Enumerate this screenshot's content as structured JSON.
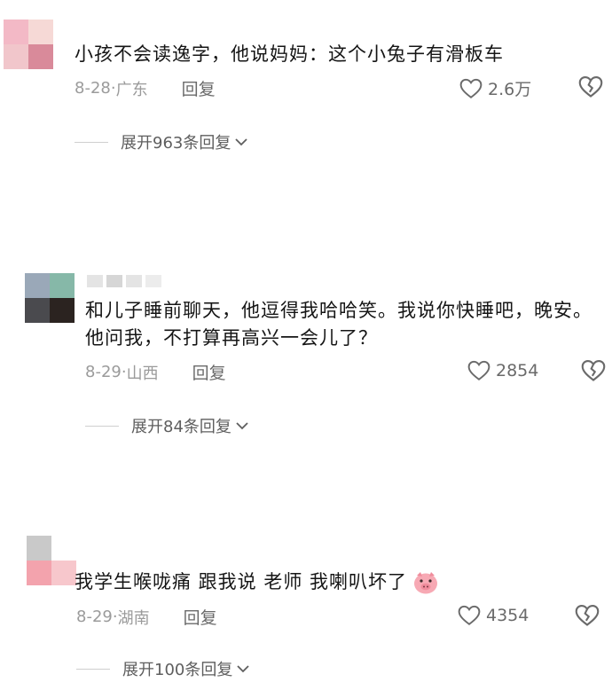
{
  "comments": [
    {
      "text": "小孩不会读逸字，他说妈妈：这个小兔子有滑板车",
      "date": "8-28",
      "location": "广东",
      "reply_label": "回复",
      "likes": "2.6万",
      "expand_label": "展开963条回复",
      "avatar_colors": [
        "#f3b9c6",
        "#f6d9d6",
        "#f1c6cb",
        "#d98a9a"
      ]
    },
    {
      "text": "和儿子睡前聊天，他逗得我哈哈笑。我说你快睡吧，晚安。他问我，不打算再高兴一会儿了？",
      "date": "8-29",
      "location": "山西",
      "reply_label": "回复",
      "likes": "2854",
      "expand_label": "展开84条回复",
      "avatar_colors": [
        "#9aa8b8",
        "#86b8a8",
        "#4a4a4e",
        "#2b2320"
      ]
    },
    {
      "text": "我学生喉咙痛 跟我说 老师 我喇叭坏了",
      "emoji": "pig-face-icon",
      "date": "8-29",
      "location": "湖南",
      "reply_label": "回复",
      "likes": "4354",
      "expand_label": "展开100条回复",
      "avatar_colors": [
        "#c9c9c9",
        "#ffffff",
        "#f3a3ad",
        "#f7c7cc"
      ]
    }
  ],
  "colors": {
    "text": "#151515",
    "meta": "#9b9b9b",
    "action": "#6a6a6a"
  }
}
